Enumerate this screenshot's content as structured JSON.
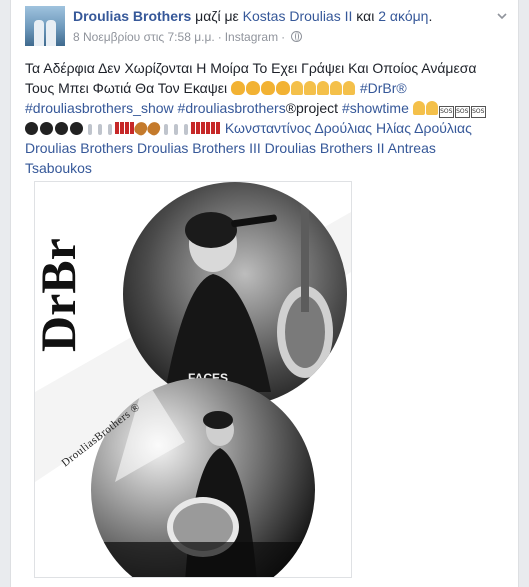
{
  "post": {
    "author": "Droulias Brothers",
    "with_text": "μαζί με",
    "tagged": "Kostas Droulias II",
    "and_text": "και",
    "others": "2 ακόμη",
    "period": ".",
    "timestamp": "8 Νοεμβρίου στις 7:58 μ.μ.",
    "separator": "·",
    "via": "Instagram",
    "separator2": "·",
    "line1": "Τα Αδέρφια Δεν Χωρίζονται Η Μοίρα Το Εχει Γράψει Και Οποίος Ανάμεσα",
    "line2_text": "Τους Μπει Φωτιά Θα Τον Εκαψει",
    "hashtag_drbr": "#DrBr®",
    "hashtag_show": "#drouliasbrothers_show",
    "hashtag_project": "#drouliasbrothers",
    "project_suffix": "®project",
    "hashtag_showtime": "#showtime",
    "sos": "SOS",
    "mention1": "Κωνσταντίνος Δρούλιας",
    "mention2": "Ηλίας Δρούλιας",
    "mention3": "Droulias Brothers",
    "mention4": "Droulias Brothers III",
    "mention5": "Droulias Brothers II",
    "mention6": "Antreas",
    "mention6b": "Tsaboukos",
    "space": " "
  },
  "photo": {
    "logo_text": "DrBr",
    "watermark": "DrouliasBrothers ®",
    "badge": "FACES"
  },
  "colors": {
    "link": "#365899",
    "text": "#1d2129",
    "meta": "#90949c",
    "background": "#e9ebee"
  },
  "icons": [
    "globe-icon",
    "chevron-down-icon",
    "flexed-biceps-emoji",
    "folded-hands-emoji",
    "sos-emoji",
    "bomb-emoji",
    "microphone-emoji",
    "guitar-emoji",
    "exclamation-emoji"
  ]
}
